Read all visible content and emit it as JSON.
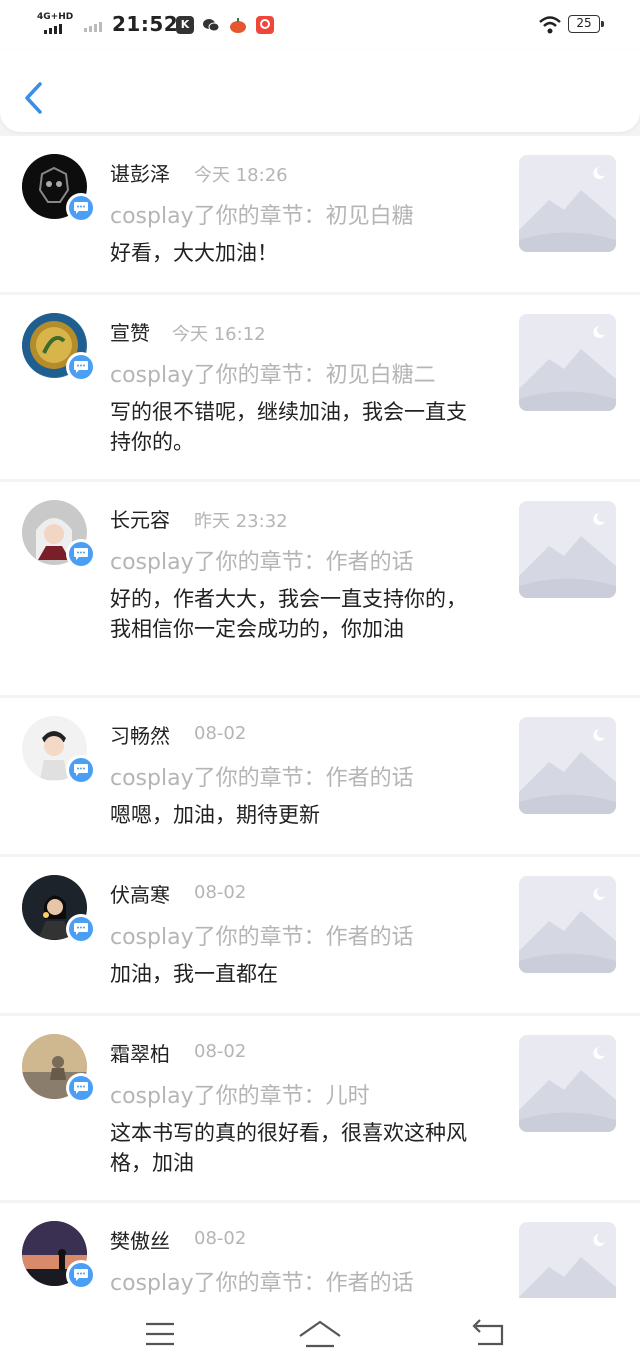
{
  "status_bar": {
    "network": "4G+HD",
    "time": "21:52",
    "battery": "25",
    "icons": [
      "k-app-icon",
      "wechat-icon",
      "pumpkin-app-icon",
      "shopping-app-icon"
    ]
  },
  "header": {
    "back_icon": "chevron-left-icon",
    "accent": "#3a8ee6"
  },
  "notifications": [
    {
      "user": "谌彭泽",
      "time": "今天 18:26",
      "chapter": "cosplay了你的章节：初见白糖",
      "comment": "好看，大大加油！"
    },
    {
      "user": "宣赞",
      "time": "今天 16:12",
      "chapter": "cosplay了你的章节：初见白糖二",
      "comment": "写的很不错呢，继续加油，我会一直支持你的。"
    },
    {
      "user": "长元容",
      "time": "昨天 23:32",
      "chapter": "cosplay了你的章节：作者的话",
      "comment": "好的，作者大大，我会一直支持你的，我相信你一定会成功的，你加油"
    },
    {
      "user": "习畅然",
      "time": "08-02",
      "chapter": "cosplay了你的章节：作者的话",
      "comment": "嗯嗯，加油，期待更新"
    },
    {
      "user": "伏高寒",
      "time": "08-02",
      "chapter": "cosplay了你的章节：作者的话",
      "comment": "加油，我一直都在"
    },
    {
      "user": "霜翠柏",
      "time": "08-02",
      "chapter": "cosplay了你的章节：儿时",
      "comment": "这本书写的真的很好看，很喜欢这种风格，加油"
    },
    {
      "user": "樊傲丝",
      "time": "08-02",
      "chapter": "cosplay了你的章节：作者的话",
      "comment": ""
    }
  ],
  "colors": {
    "badge": "#4a9ff5",
    "muted_text": "#b5b5b5",
    "thumb_bg": "#e8e9f1"
  },
  "nav": {
    "icons": [
      "menu-icon",
      "home-icon",
      "back-icon"
    ]
  }
}
